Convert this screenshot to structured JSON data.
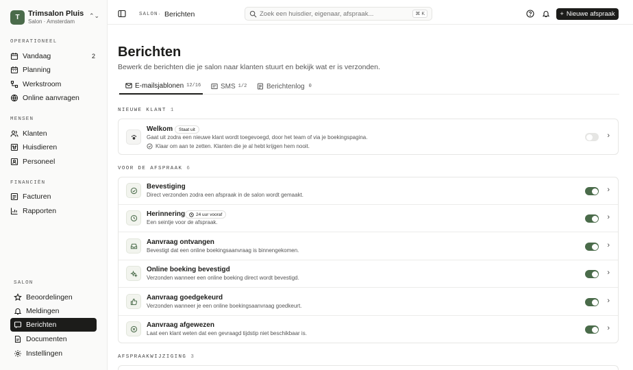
{
  "brand": {
    "initial": "T",
    "name": "Trimsalon Pluis",
    "subtitle": "Salon · Amsterdam"
  },
  "sidebar": {
    "sections": [
      {
        "label": "OPERATIONEEL",
        "items": [
          {
            "label": "Vandaag",
            "count": "2",
            "icon": "calendar-icon"
          },
          {
            "label": "Planning",
            "icon": "calendar-grid-icon"
          },
          {
            "label": "Werkstroom",
            "icon": "flow-icon"
          },
          {
            "label": "Online aanvragen",
            "icon": "globe-icon"
          }
        ]
      },
      {
        "label": "MENSEN",
        "items": [
          {
            "label": "Klanten",
            "icon": "users-icon"
          },
          {
            "label": "Huisdieren",
            "icon": "paw-icon"
          },
          {
            "label": "Personeel",
            "icon": "id-card-icon"
          }
        ]
      },
      {
        "label": "FINANCIËN",
        "items": [
          {
            "label": "Facturen",
            "icon": "invoice-icon"
          },
          {
            "label": "Rapporten",
            "icon": "chart-icon"
          }
        ]
      },
      {
        "label": "SALON",
        "items": [
          {
            "label": "Beoordelingen",
            "icon": "star-icon"
          },
          {
            "label": "Meldingen",
            "icon": "bell-icon"
          },
          {
            "label": "Berichten",
            "icon": "message-icon",
            "active": true
          },
          {
            "label": "Documenten",
            "icon": "document-icon"
          },
          {
            "label": "Instellingen",
            "icon": "settings-icon"
          }
        ]
      }
    ]
  },
  "topbar": {
    "crumb1": "SALON",
    "crumb_sep": "·",
    "crumb2": "Berichten",
    "search_placeholder": "Zoek een huisdier, eigenaar, afspraak...",
    "shortcut": "⌘ K",
    "new_button": "Nieuwe afspraak"
  },
  "page": {
    "title": "Berichten",
    "subtitle": "Bewerk de berichten die je salon naar klanten stuurt en bekijk wat er is verzonden."
  },
  "tabs": [
    {
      "label": "E-mailsjablonen",
      "count": "12/16",
      "active": true
    },
    {
      "label": "SMS",
      "count": "1/2"
    },
    {
      "label": "Berichtenlog",
      "count": "0"
    }
  ],
  "groups": [
    {
      "label": "NIEUWE KLANT",
      "count": "1",
      "items": [
        {
          "title": "Welkom",
          "badge": "Staat uit",
          "desc": "Gaat uit zodra een nieuwe klant wordt toegevoegd, door het team of via je boekingspagina.",
          "note": "Klaar om aan te zetten. Klanten die je al hebt krijgen hem nooit.",
          "enabled": false,
          "icon": "paw-icon"
        }
      ]
    },
    {
      "label": "VOOR DE AFSPRAAK",
      "count": "6",
      "items": [
        {
          "title": "Bevestiging",
          "desc": "Direct verzonden zodra een afspraak in de salon wordt gemaakt.",
          "enabled": true,
          "icon": "check-circle-icon"
        },
        {
          "title": "Herinnering",
          "badge": "24 uur vooraf",
          "desc": "Een seintje voor de afspraak.",
          "enabled": true,
          "icon": "clock-icon"
        },
        {
          "title": "Aanvraag ontvangen",
          "desc": "Bevestigt dat een online boekingsaanvraag is binnengekomen.",
          "enabled": true,
          "icon": "inbox-icon"
        },
        {
          "title": "Online boeking bevestigd",
          "desc": "Verzonden wanneer een online boeking direct wordt bevestigd.",
          "enabled": true,
          "icon": "sparkle-icon"
        },
        {
          "title": "Aanvraag goedgekeurd",
          "desc": "Verzonden wanneer je een online boekingsaanvraag goedkeurt.",
          "enabled": true,
          "icon": "thumbs-up-icon"
        },
        {
          "title": "Aanvraag afgewezen",
          "desc": "Laat een klant weten dat een gevraagd tijdstip niet beschikbaar is.",
          "enabled": true,
          "icon": "x-circle-icon"
        }
      ]
    },
    {
      "label": "AFSPRAAKWIJZIGING",
      "count": "3",
      "items": []
    }
  ]
}
